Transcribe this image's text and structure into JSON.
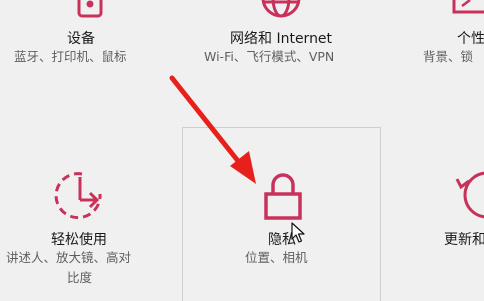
{
  "accent_color": "#c8325a",
  "arrow_color": "#e8201c",
  "tiles": [
    {
      "id": "devices",
      "title": "设备",
      "desc": "蓝牙、打印机、鼠标",
      "icon": "keyboard-icon"
    },
    {
      "id": "network",
      "title": "网络和 Internet",
      "desc": "Wi-Fi、飞行模式、VPN",
      "icon": "globe-icon"
    },
    {
      "id": "personalization",
      "title": "个性",
      "desc": "背景、锁",
      "icon": "paint-icon"
    },
    {
      "id": "ease",
      "title": "轻松使用",
      "desc_lines": [
        "讲述人、放大镜、高对",
        "比度"
      ],
      "icon": "ease-of-access-icon"
    },
    {
      "id": "privacy",
      "title": "隐私",
      "desc": "位置、相机",
      "icon": "lock-icon"
    },
    {
      "id": "update",
      "title": "更新和",
      "desc": "",
      "icon": "refresh-icon"
    }
  ]
}
